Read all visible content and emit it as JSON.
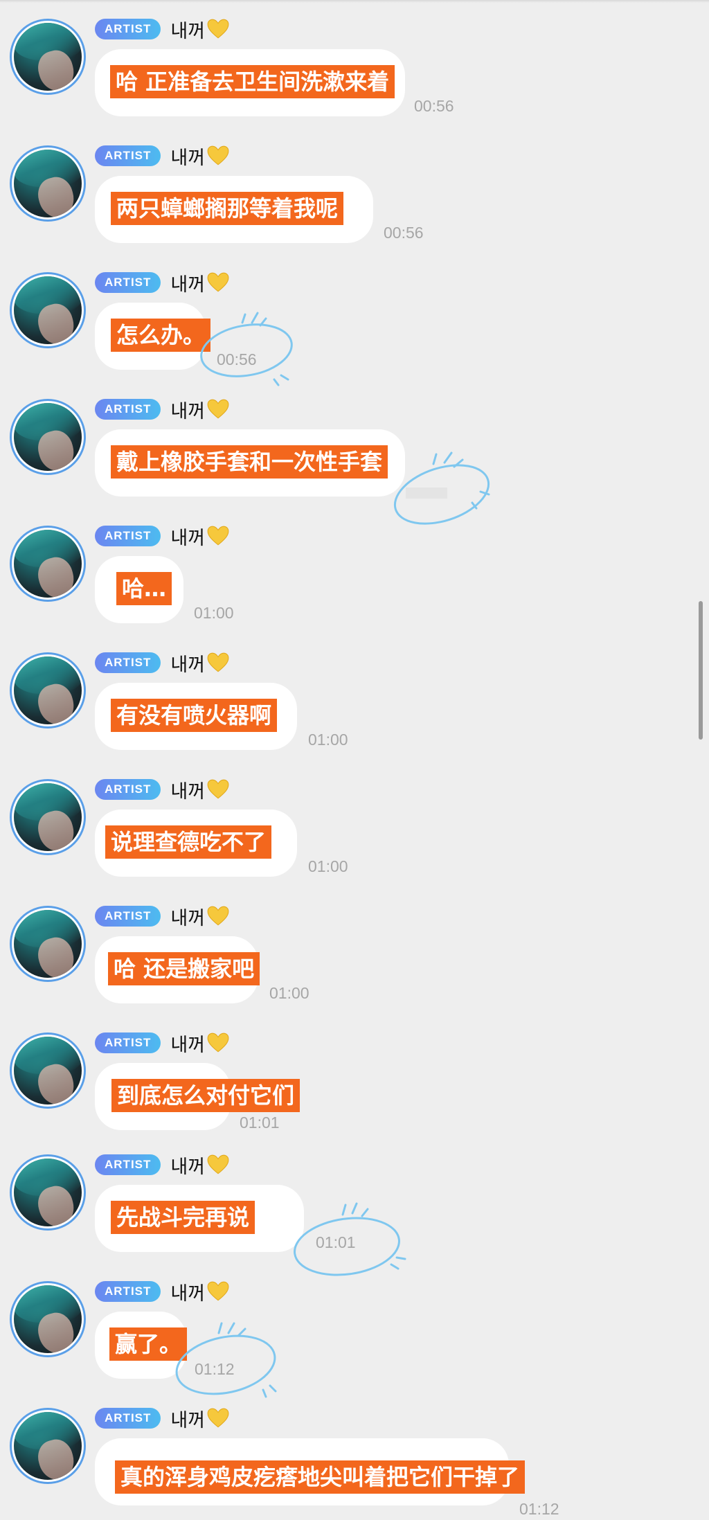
{
  "chat": {
    "sender_badge": "ARTIST",
    "sender_name": "내꺼",
    "sender_emoji_icon": "yellow-heart-icon",
    "highlight_color": "#f3671d",
    "badge_gradient": [
      "#6b86f0",
      "#4dbbf0"
    ],
    "avatar_ring_color": "#5a9fe8",
    "messages": [
      {
        "text": "哈 正准备去卫生间洗漱来着",
        "time": "00:56"
      },
      {
        "text": "两只蟑螂搁那等着我呢",
        "time": "00:56"
      },
      {
        "text": "怎么办。",
        "time": "00:56"
      },
      {
        "text": "戴上橡胶手套和一次性手套",
        "time": ""
      },
      {
        "text": "哈…",
        "time": "01:00"
      },
      {
        "text": "有没有喷火器啊",
        "time": "01:00"
      },
      {
        "text": "说理查德吃不了",
        "time": "01:00"
      },
      {
        "text": "哈 还是搬家吧",
        "time": "01:00"
      },
      {
        "text": "到底怎么对付它们",
        "time": "01:01"
      },
      {
        "text": "先战斗完再说",
        "time": "01:01"
      },
      {
        "text": "赢了。",
        "time": "01:12"
      },
      {
        "text": "真的浑身鸡皮疙瘩地尖叫着把它们干掉了",
        "time": "01:12"
      }
    ]
  }
}
